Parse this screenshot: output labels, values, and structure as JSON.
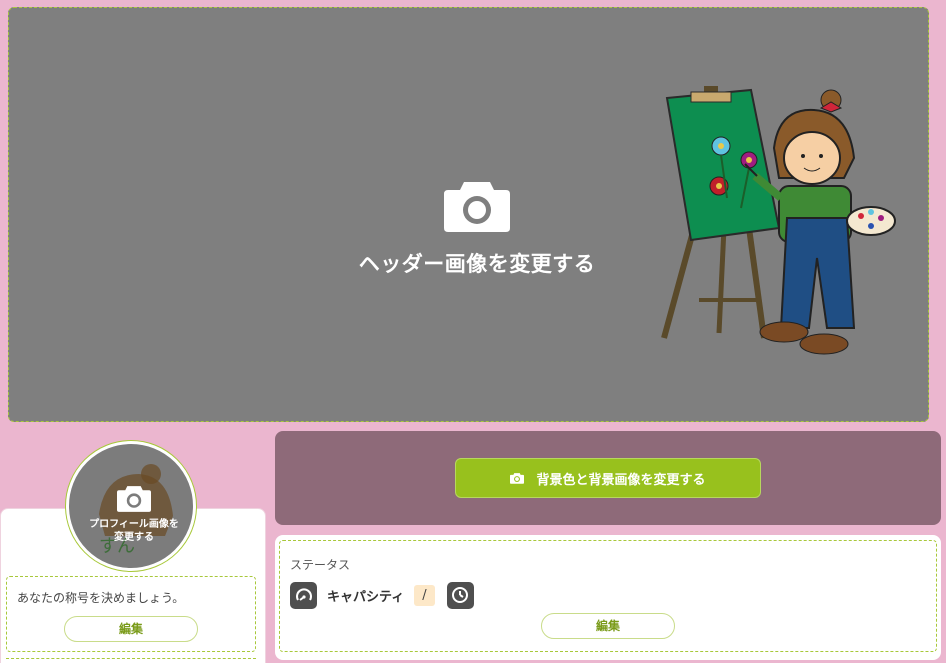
{
  "header": {
    "change_label": "ヘッダー画像を変更する"
  },
  "profile": {
    "change_label": "プロフィール画像を\n変更する"
  },
  "title_box": {
    "hint": "あなたの称号を決めましょう。",
    "edit_label": "編集"
  },
  "background": {
    "change_label": "背景色と背景画像を変更する"
  },
  "status": {
    "title": "ステータス",
    "capacity_label": "キャパシティ",
    "separator": "/",
    "edit_label": "編集"
  },
  "colors": {
    "page_bg": "#ebb6cf",
    "overlay": "#7f7f7f",
    "accent": "#98c11d",
    "panel": "#8e6a79",
    "dashed": "#a8c83a"
  },
  "icons": [
    "camera-icon",
    "gauge-icon",
    "clock-icon"
  ]
}
